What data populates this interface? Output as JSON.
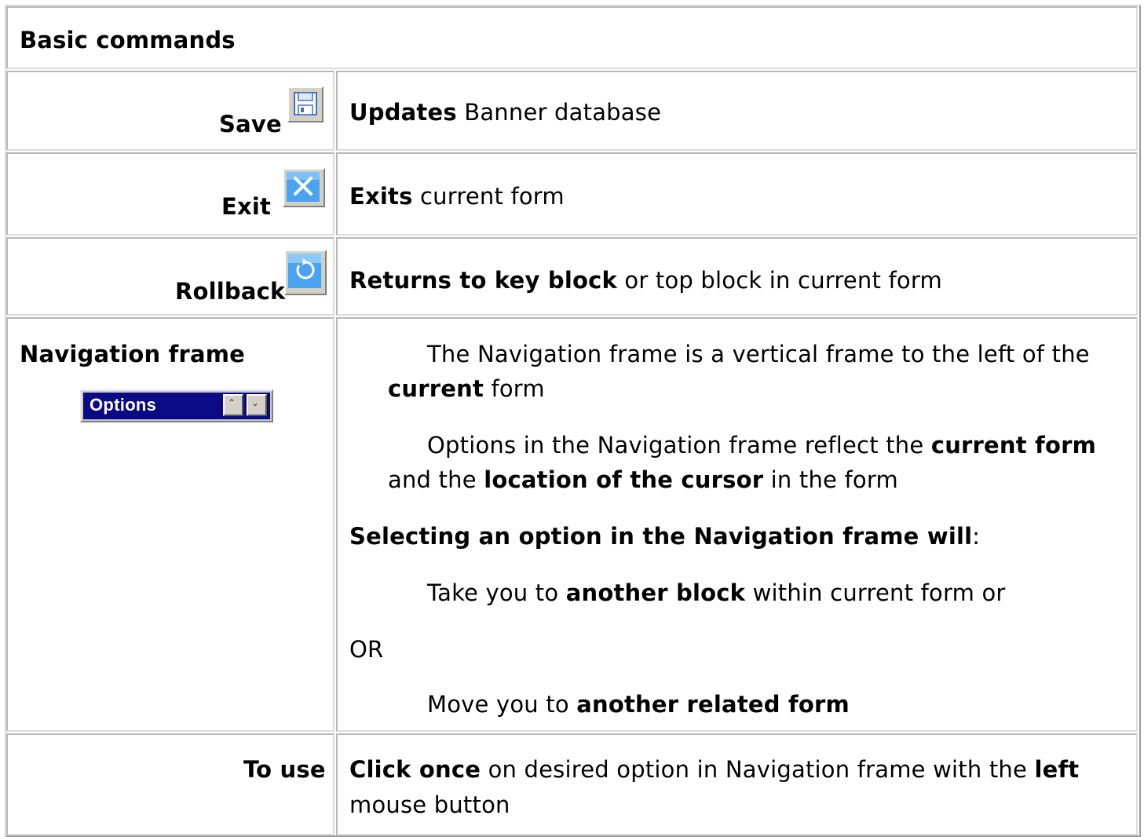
{
  "header": {
    "title": "Basic commands"
  },
  "rows": [
    {
      "label": "Save",
      "icon": "save-floppy-icon",
      "desc_bold": "Updates",
      "desc_rest": " Banner database"
    },
    {
      "label": "Exit",
      "icon": "exit-x-icon",
      "desc_bold": "Exits",
      "desc_rest": " current form"
    },
    {
      "label": "Rollback",
      "icon": "rollback-arrow-icon",
      "desc_bold": "Returns to key block",
      "desc_rest": " or top block in current form"
    }
  ],
  "navigation": {
    "label": "Navigation frame",
    "widget_label": "Options",
    "para1": {
      "a": "The Navigation frame is a vertical frame to the left of the",
      "b_bold": "current",
      "b_rest": " form"
    },
    "para2": {
      "a": "Options in the Navigation frame reflect the ",
      "a_bold": "current form",
      "b_pre": "and the ",
      "b_bold": "location of the cursor",
      "b_rest": " in the form"
    },
    "selecting_bold": "Selecting an option in the Navigation frame will",
    "selecting_rest": ":",
    "opt1_pre": "Take you to ",
    "opt1_bold": "another block",
    "opt1_rest": " within current form or",
    "or_text": "OR",
    "opt2_pre": "Move you to ",
    "opt2_bold": "another related form"
  },
  "to_use": {
    "label": "To use",
    "l1_bold": "Click once",
    "l1_mid": " on desired option in Navigation frame with the ",
    "l1_bold2": "left",
    "l2": "mouse button"
  }
}
